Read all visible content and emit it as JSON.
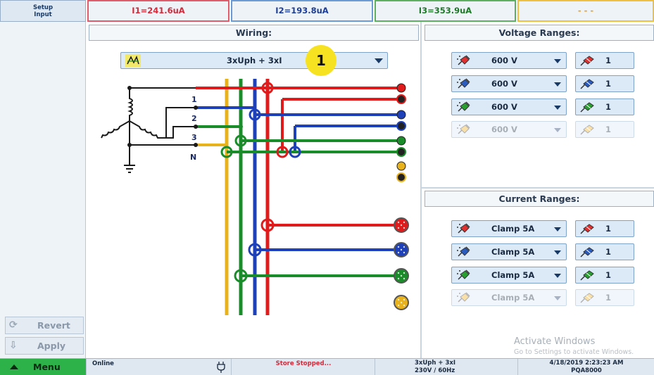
{
  "top": {
    "setup_line1": "Setup",
    "setup_line2": "Input",
    "i1": "I1=241.6uA",
    "i2": "I2=193.8uA",
    "i3": "I3=353.9uA",
    "i4": "- - -"
  },
  "left": {
    "revert_label": "Revert",
    "apply_label": "Apply"
  },
  "wiring": {
    "header": "Wiring:",
    "selected": "3xUph + 3xI",
    "badge": "1",
    "line_labels": [
      "1",
      "2",
      "3",
      "N"
    ]
  },
  "voltage": {
    "header": "Voltage Ranges:",
    "rows": [
      {
        "value": "600 V",
        "mult": "1",
        "color": "#e03030"
      },
      {
        "value": "600 V",
        "mult": "1",
        "color": "#2a5cc0"
      },
      {
        "value": "600 V",
        "mult": "1",
        "color": "#28a030"
      },
      {
        "value": "600 V",
        "mult": "1",
        "color": "#f0b020"
      }
    ]
  },
  "current": {
    "header": "Current Ranges:",
    "rows": [
      {
        "value": "Clamp 5A",
        "mult": "1",
        "color": "#e03030"
      },
      {
        "value": "Clamp 5A",
        "mult": "1",
        "color": "#2a5cc0"
      },
      {
        "value": "Clamp 5A",
        "mult": "1",
        "color": "#28a030"
      },
      {
        "value": "Clamp 5A",
        "mult": "1",
        "color": "#f0b020"
      }
    ]
  },
  "watermark": {
    "line1": "Activate Windows",
    "line2": "Go to Settings to activate Windows."
  },
  "status": {
    "menu": "Menu",
    "online": "Online",
    "store": "Store Stopped...",
    "wiring_line1": "3xUph + 3xI",
    "wiring_line2": "230V / 60Hz",
    "datetime": "4/18/2019 2:23:23 AM",
    "device": "PQA8000"
  },
  "colors": {
    "L1": "#e01b1b",
    "L2": "#1e40b8",
    "L3": "#1a8c2a",
    "N": "#e8b21c",
    "frame": "#1a1a1a"
  }
}
